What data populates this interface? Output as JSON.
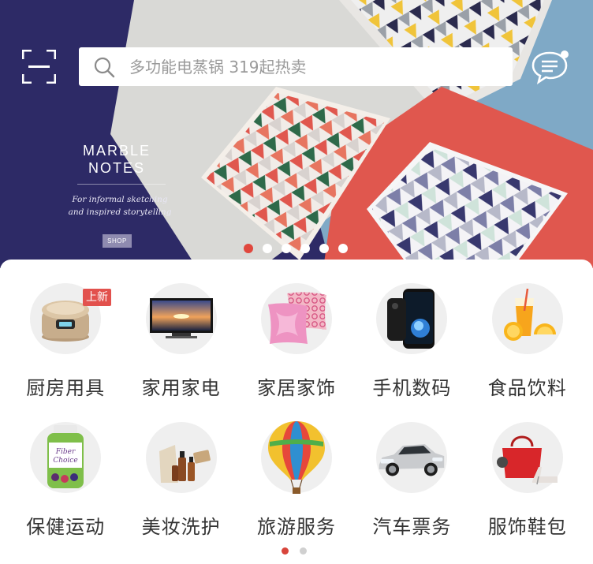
{
  "search": {
    "placeholder": "多功能电蒸锅 319起热卖"
  },
  "banner": {
    "title": "MARBLE\nNOTES",
    "subtitle": "For informal sketching\nand inspired storytelling",
    "shop_label": "SHOP",
    "slide_count": 6,
    "active_slide": 1
  },
  "categories": [
    {
      "label": "厨房用具",
      "badge": "上新",
      "icon": "rice-cooker-icon"
    },
    {
      "label": "家用家电",
      "icon": "television-icon"
    },
    {
      "label": "家居家饰",
      "icon": "pillow-icon"
    },
    {
      "label": "手机数码",
      "icon": "smartphone-icon"
    },
    {
      "label": "食品饮料",
      "icon": "juice-icon"
    },
    {
      "label": "保健运动",
      "icon": "supplement-bottle-icon"
    },
    {
      "label": "美妆洗护",
      "icon": "cosmetics-icon"
    },
    {
      "label": "旅游服务",
      "icon": "hot-air-balloon-icon"
    },
    {
      "label": "汽车票务",
      "icon": "car-icon"
    },
    {
      "label": "服饰鞋包",
      "icon": "handbag-icon"
    }
  ],
  "category_pages": {
    "count": 2,
    "active": 1
  },
  "colors": {
    "accent": "#e0473d",
    "banner_navy": "#2d2a66",
    "banner_coral": "#e0574e",
    "banner_sky": "#7fa9c6"
  }
}
